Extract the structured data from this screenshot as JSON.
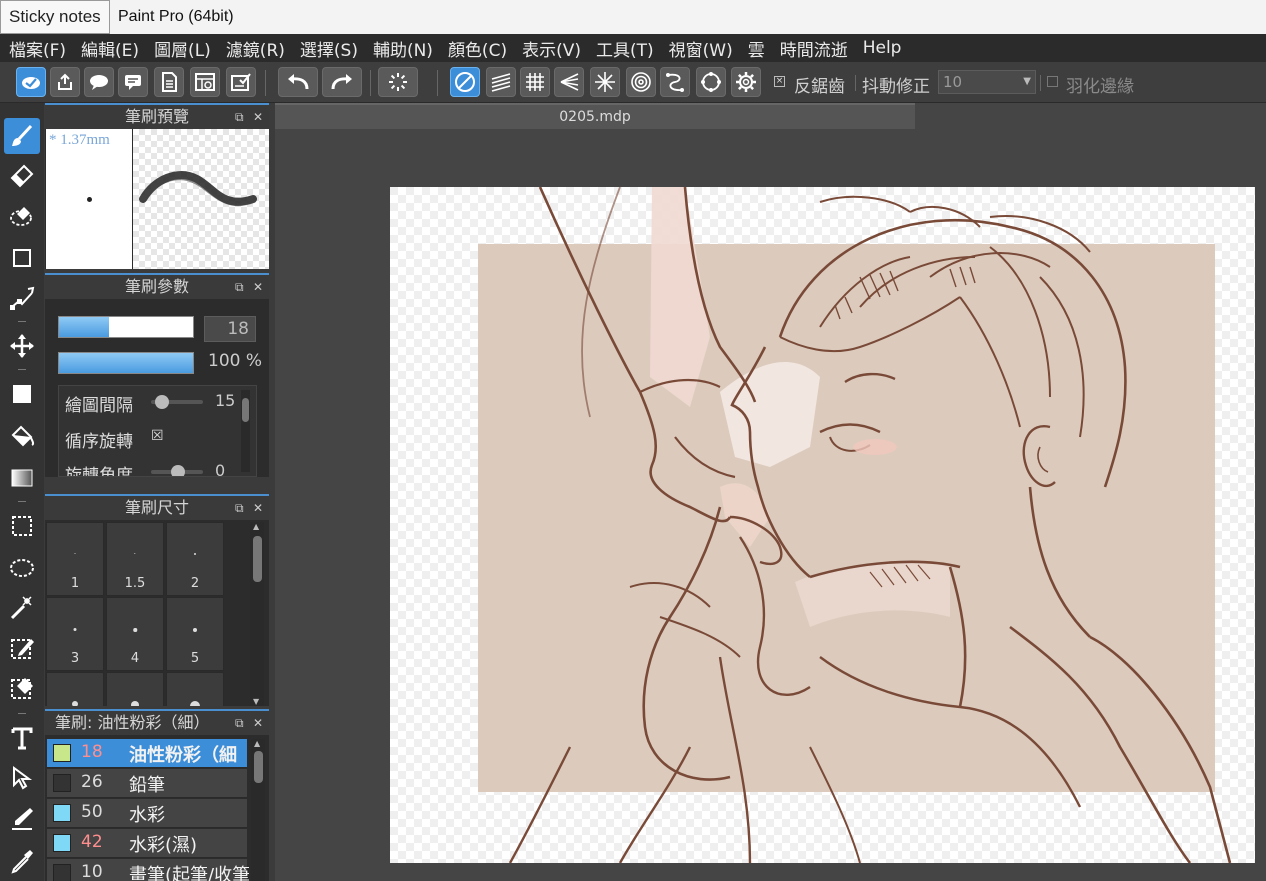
{
  "app": {
    "title": "Paint Pro (64bit)",
    "tooltip": "Sticky notes"
  },
  "menu": [
    "檔案(F)",
    "編輯(E)",
    "圖層(L)",
    "濾鏡(R)",
    "選擇(S)",
    "輔助(N)",
    "顏色(C)",
    "表示(V)",
    "工具(T)",
    "視窗(W)",
    "雲",
    "時間流逝",
    "Help"
  ],
  "toolbar": {
    "antialias_label": "反鋸齒",
    "stabilizer_label": "抖動修正",
    "stabilizer_value": "10",
    "feather_label": "羽化邊緣"
  },
  "brush_preview": {
    "title": "筆刷預覽",
    "size_label": "* 1.37mm"
  },
  "brush_params": {
    "title": "筆刷參數",
    "size_value": "18",
    "size_fill": 0.37,
    "opacity_value": "100 %",
    "opacity_fill": 1.0,
    "interval_label": "繪圖間隔",
    "interval_value": "15",
    "rotate_label": "循序旋轉",
    "rotate_check": "☒",
    "angle_label": "旋轉角度",
    "angle_value": "0"
  },
  "brush_size": {
    "title": "筆刷尺寸",
    "cells": [
      "1",
      "1.5",
      "2",
      "3",
      "4",
      "5"
    ]
  },
  "brush_list": {
    "title": "筆刷: 油性粉彩（細）",
    "items": [
      {
        "num": "18",
        "name": "油性粉彩（細",
        "color": "#c8e68a",
        "num_color": "#ff8f8f",
        "selected": true
      },
      {
        "num": "26",
        "name": "鉛筆",
        "color": "#333333",
        "num_color": "#dddddd",
        "selected": false
      },
      {
        "num": "50",
        "name": "水彩",
        "color": "#7fd8f5",
        "num_color": "#dddddd",
        "selected": false
      },
      {
        "num": "42",
        "name": "水彩(濕)",
        "color": "#7fd8f5",
        "num_color": "#ff8f8f",
        "selected": false
      },
      {
        "num": "10",
        "name": "畫筆(起筆/收筆",
        "color": "#333333",
        "num_color": "#dddddd",
        "selected": false
      }
    ]
  },
  "document": {
    "tab": "0205.mdp"
  },
  "colors": {
    "accent": "#3d8ed8",
    "art_bg": "#dccbbd",
    "line": "#7a4a38"
  }
}
